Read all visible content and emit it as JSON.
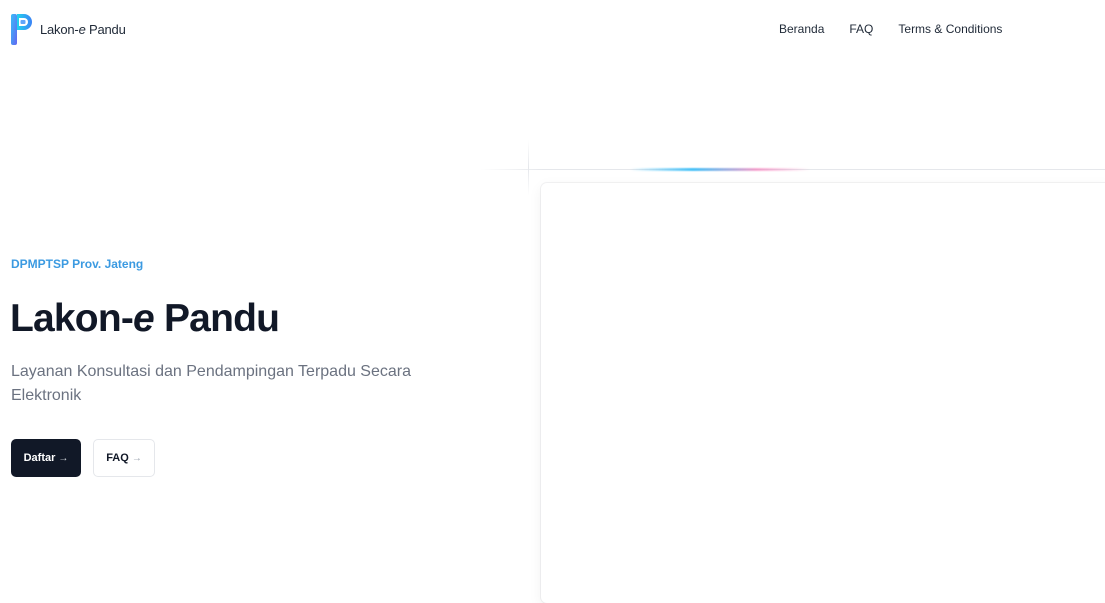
{
  "brand": {
    "name_prefix": "Lakon-",
    "name_italic": "e",
    "name_suffix": " Pandu"
  },
  "nav": {
    "items": [
      {
        "label": "Beranda"
      },
      {
        "label": "FAQ"
      },
      {
        "label": "Terms & Conditions"
      }
    ]
  },
  "hero": {
    "eyebrow": "DPMPTSP Prov. Jateng",
    "title_prefix": "Lakon-",
    "title_italic": "e",
    "title_suffix": " Pandu",
    "subtitle": "Layanan Konsultasi dan Pendampingan Terpadu Secara Elektronik",
    "primary_button": {
      "label": "Daftar",
      "icon": "arrow-right-icon",
      "glyph": "→"
    },
    "secondary_button": {
      "label": "FAQ",
      "icon": "arrow-right-icon",
      "glyph": "→"
    }
  },
  "colors": {
    "accent": "#3b9ae1",
    "primary_button_bg": "#111827",
    "text_muted": "#6b7280"
  }
}
